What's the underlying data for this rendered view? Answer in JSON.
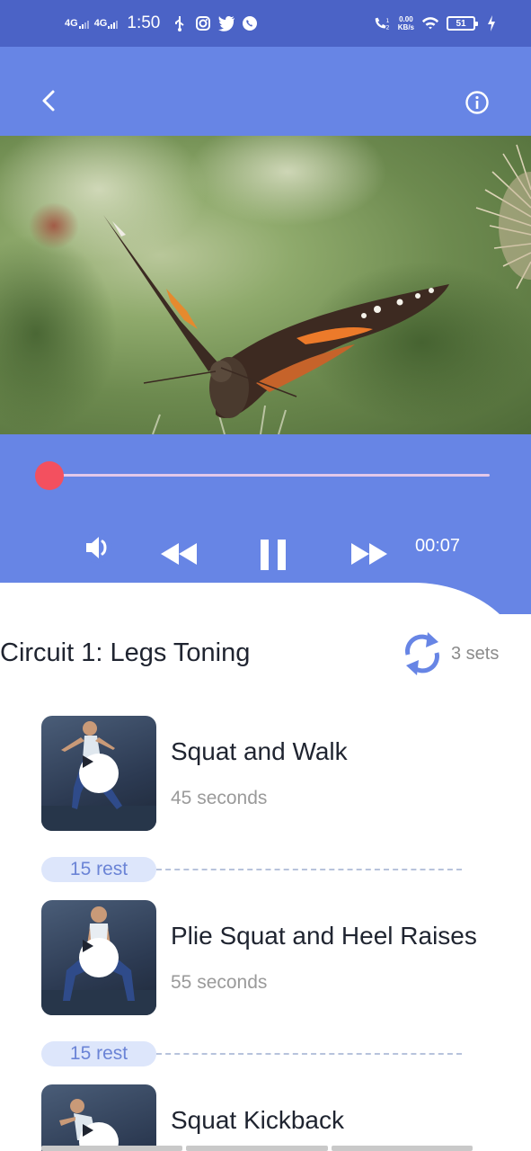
{
  "status_bar": {
    "network1": "4G",
    "network2": "4G",
    "time": "1:50",
    "speed_value": "0.00",
    "speed_unit": "KB/s",
    "battery": "51",
    "icons": [
      "usb-icon",
      "instagram-icon",
      "twitter-icon",
      "whatsapp-icon",
      "wifi-call-icon",
      "wifi-icon",
      "charging-icon"
    ]
  },
  "app_bar": {
    "back_icon": "chevron-left-icon",
    "info_icon": "info-icon"
  },
  "player": {
    "progress": 0.0,
    "elapsed": "00:07",
    "icons": [
      "volume-icon",
      "rewind-icon",
      "pause-icon",
      "fast-forward-icon"
    ]
  },
  "circuit": {
    "title": "Circuit 1: Legs Toning",
    "sets": "3 sets",
    "sets_icon": "repeat-icon"
  },
  "exercises": [
    {
      "name": "Squat and Walk",
      "duration": "45 seconds"
    },
    {
      "name": "Plie Squat and Heel Raises",
      "duration": "55 seconds"
    },
    {
      "name": "Squat Kickback",
      "duration": ""
    }
  ],
  "rests": [
    {
      "label": "15 rest"
    },
    {
      "label": "15 rest"
    }
  ],
  "colors": {
    "status_bar": "#4b63c6",
    "primary": "#6785e5",
    "seek_thumb": "#f3505f",
    "rest_pill_bg": "#dde6fb",
    "rest_pill_text": "#6b84d6"
  }
}
